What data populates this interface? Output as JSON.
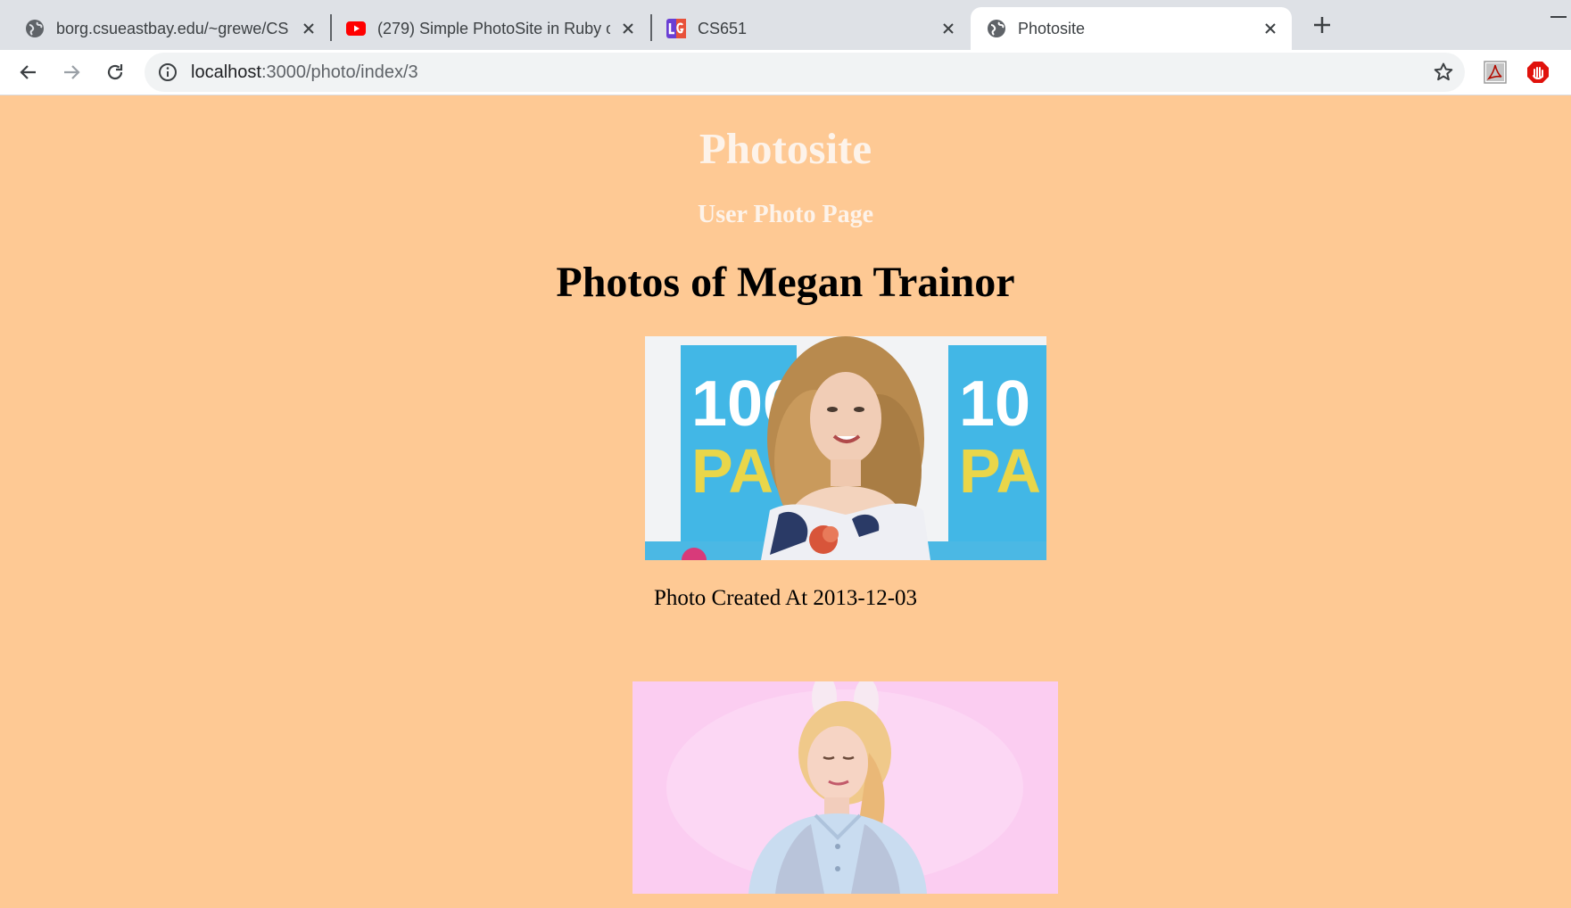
{
  "browser": {
    "tabs": [
      {
        "title": "borg.csueastbay.edu/~grewe/CS",
        "favicon": "globe-icon",
        "active": false
      },
      {
        "title": "(279) Simple PhotoSite in Ruby o",
        "favicon": "youtube-icon",
        "active": false
      },
      {
        "title": "CS651",
        "favicon": "lg-icon",
        "active": false
      },
      {
        "title": "Photosite",
        "favicon": "globe-icon",
        "active": true
      }
    ],
    "url": {
      "host": "localhost",
      "path": ":3000/photo/index/3"
    }
  },
  "page": {
    "site_title": "Photosite",
    "subtitle": "User Photo Page",
    "heading": "Photos of Megan Trainor",
    "photos": [
      {
        "caption": "Photo Created At 2013-12-03",
        "alt": "Megan Trainor at a 106 & Park event"
      },
      {
        "caption": "",
        "alt": "Megan Trainor on a pink background"
      }
    ]
  },
  "colors": {
    "page_background": "#fec994",
    "title_color": "#fdf3ea",
    "tabstrip": "#dee1e6"
  }
}
